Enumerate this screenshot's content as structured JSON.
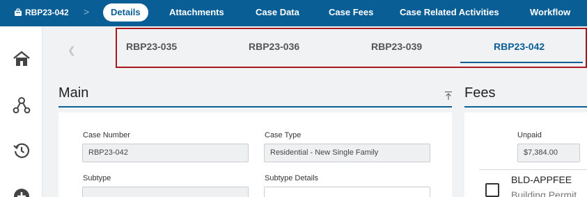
{
  "header": {
    "case_id": "RBP23-042",
    "separator": ">",
    "tabs": [
      {
        "label": "Details",
        "active": true
      },
      {
        "label": "Attachments",
        "active": false
      },
      {
        "label": "Case Data",
        "active": false
      },
      {
        "label": "Case Fees",
        "active": false
      },
      {
        "label": "Case Related Activities",
        "active": false
      },
      {
        "label": "Workflow",
        "active": false
      }
    ]
  },
  "case_tabs": {
    "prev_icon": "chevron-left-icon",
    "items": [
      {
        "label": "RBP23-035",
        "active": false
      },
      {
        "label": "RBP23-036",
        "active": false
      },
      {
        "label": "RBP23-039",
        "active": false
      },
      {
        "label": "RBP23-042",
        "active": true
      }
    ]
  },
  "left_rail": {
    "icons": [
      "home-icon",
      "network-icon",
      "history-icon",
      "add-circle-icon"
    ]
  },
  "main": {
    "title": "Main",
    "case_number_label": "Case Number",
    "case_number_value": "RBP23-042",
    "case_type_label": "Case Type",
    "case_type_value": "Residential - New Single Family",
    "subtype_label": "Subtype",
    "subtype_value": "",
    "subtype_details_label": "Subtype Details",
    "subtype_details_value": ""
  },
  "fees": {
    "title": "Fees",
    "unpaid_label": "Unpaid",
    "unpaid_value": "$7,384.00",
    "items": [
      {
        "code": "BLD-APPFEE",
        "description": "Building Permit"
      }
    ]
  },
  "colors": {
    "brand": "#0a5e96",
    "highlight_border": "#a8171c"
  }
}
